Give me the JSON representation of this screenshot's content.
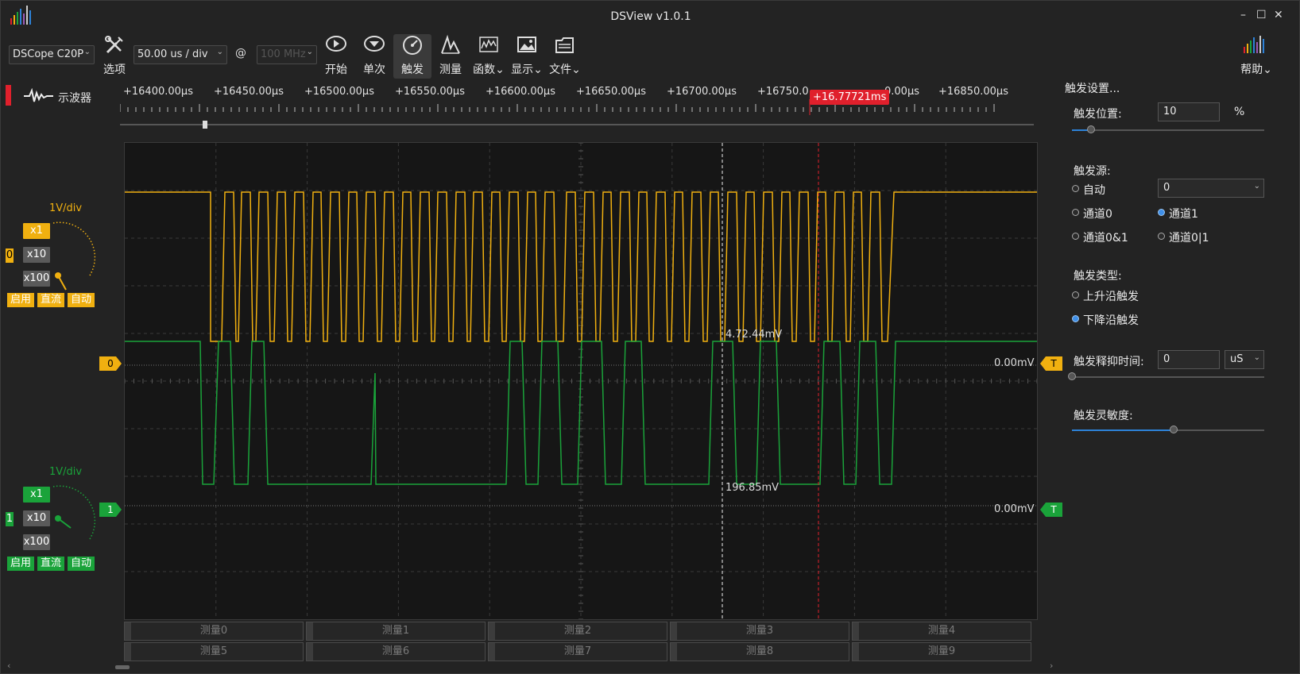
{
  "window": {
    "title": "DSView v1.0.1",
    "min_label": "–",
    "max_label": "☐",
    "close_label": "✕"
  },
  "toolbar": {
    "device": "DSCope C20P",
    "options_label": "选项",
    "timebase": "50.00 us / div",
    "at": "@",
    "samplerate": "100 MHz",
    "start_label": "开始",
    "single_label": "单次",
    "trigger_label": "触发",
    "measure_label": "测量",
    "function_label": "函数",
    "display_label": "显示",
    "file_label": "文件",
    "help_label": "帮助"
  },
  "mode_tab": {
    "label": "示波器"
  },
  "ruler": {
    "labels": [
      "+16400.00μs",
      "+16450.00μs",
      "+16500.00μs",
      "+16550.00μs",
      "+16600.00μs",
      "+16650.00μs",
      "+16700.00μs",
      "+16750.0",
      "0.00μs",
      "+16850.00μs"
    ],
    "cursor_time": "+16.77721ms",
    "cursor_tag": "T"
  },
  "channels": [
    {
      "id": "0",
      "color": "#f0b010",
      "vdiv": "1V/div",
      "x1": "x1",
      "x10": "x10",
      "x100": "x100",
      "enable": "启用",
      "coupling": "直流",
      "auto": "自动",
      "offset_label": "0.00mV",
      "trig_tag": "T",
      "measure_text": "4.72.44mV"
    },
    {
      "id": "1",
      "color": "#1aa33a",
      "vdiv": "1V/div",
      "x1": "x1",
      "x10": "x10",
      "x100": "x100",
      "enable": "启用",
      "coupling": "直流",
      "auto": "自动",
      "offset_label": "0.00mV",
      "trig_tag": "T",
      "measure_text": "196.85mV"
    }
  ],
  "measurements": [
    "测量0",
    "测量1",
    "测量2",
    "测量3",
    "测量4",
    "测量5",
    "测量6",
    "测量7",
    "测量8",
    "测量9"
  ],
  "trigger_panel": {
    "title": "触发设置...",
    "position_label": "触发位置:",
    "position_value": "10",
    "position_unit": "%",
    "position_fraction": 0.1,
    "source_label": "触发源:",
    "source_auto": "自动",
    "source_select": "0",
    "source_ch0": "通道0",
    "source_ch1": "通道1",
    "source_and": "通道0&1",
    "source_or": "通道0|1",
    "source_selected": "通道1",
    "type_label": "触发类型:",
    "type_rising": "上升沿触发",
    "type_falling": "下降沿触发",
    "type_selected": "下降沿触发",
    "holdoff_label": "触发释抑时间:",
    "holdoff_value": "0",
    "holdoff_unit": "uS",
    "holdoff_fraction": 0.0,
    "sensitivity_label": "触发灵敏度:",
    "sensitivity_fraction": 0.53
  },
  "colors": {
    "ch0": "#f0b010",
    "ch1": "#1aa33a",
    "accent": "#e0202c",
    "blue": "#2d82d8"
  }
}
